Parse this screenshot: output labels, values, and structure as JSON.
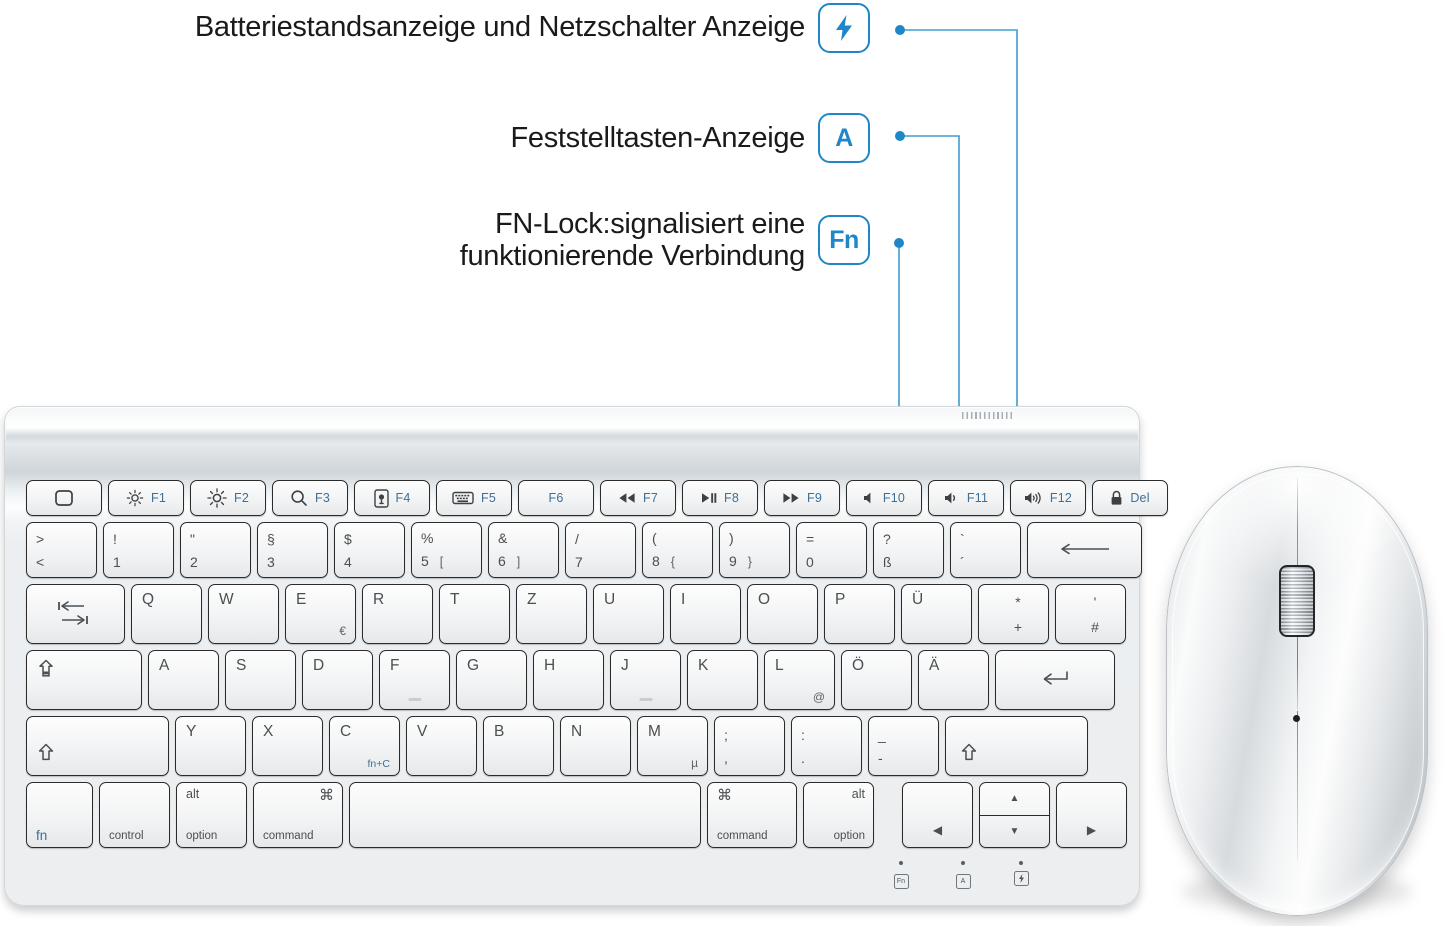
{
  "annotations": [
    {
      "id": "battery",
      "text": "Batteriestandsanzeige und Netzschalter Anzeige",
      "badge_icon": "lightning-bolt-icon",
      "badge_label": ""
    },
    {
      "id": "capslock",
      "text": "Feststelltasten-Anzeige",
      "badge_icon": "letter-a-icon",
      "badge_label": "A"
    },
    {
      "id": "fnlock",
      "text": "FN-Lock:signalisiert eine\nfunktionierende Verbindung",
      "badge_icon": "fn-icon",
      "badge_label": "Fn"
    }
  ],
  "colors": {
    "accent_blue": "#1f87c8",
    "connector_line": "#3f9dd0",
    "key_legend": "#4a4f53",
    "fn_blue": "#3f6f95",
    "body_silver": "#eceef0"
  },
  "keyboard": {
    "leds": [
      {
        "icon": "fn-indicator-icon",
        "label": "Fn"
      },
      {
        "icon": "capslock-indicator-icon",
        "label": "A"
      },
      {
        "icon": "battery-indicator-icon",
        "label": ""
      }
    ],
    "function_row": [
      {
        "glyph": "screen-icon",
        "label": ""
      },
      {
        "glyph": "brightness-down-icon",
        "label": "F1"
      },
      {
        "glyph": "brightness-up-icon",
        "label": "F2"
      },
      {
        "glyph": "search-icon",
        "label": "F3"
      },
      {
        "glyph": "microphone-icon",
        "label": "F4"
      },
      {
        "glyph": "keyboard-backlight-icon",
        "label": "F5"
      },
      {
        "glyph": "",
        "label": "F6"
      },
      {
        "glyph": "rewind-icon",
        "label": "F7"
      },
      {
        "glyph": "play-pause-icon",
        "label": "F8"
      },
      {
        "glyph": "fast-forward-icon",
        "label": "F9"
      },
      {
        "glyph": "mute-icon",
        "label": "F10"
      },
      {
        "glyph": "volume-down-icon",
        "label": "F11"
      },
      {
        "glyph": "volume-up-icon",
        "label": "F12"
      },
      {
        "glyph": "lock-icon",
        "label": "Del"
      }
    ],
    "number_row": [
      {
        "top": ">",
        "bottom": "<",
        "alt": ""
      },
      {
        "top": "!",
        "bottom": "1",
        "alt": ""
      },
      {
        "top": "\"",
        "bottom": "2",
        "alt": ""
      },
      {
        "top": "§",
        "bottom": "3",
        "alt": ""
      },
      {
        "top": "$",
        "bottom": "4",
        "alt": ""
      },
      {
        "top": "%",
        "bottom": "5",
        "alt": "["
      },
      {
        "top": "&",
        "bottom": "6",
        "alt": "]"
      },
      {
        "top": "/",
        "bottom": "7",
        "alt": ""
      },
      {
        "top": "(",
        "bottom": "8",
        "alt": "{"
      },
      {
        "top": ")",
        "bottom": "9",
        "alt": "}"
      },
      {
        "top": "=",
        "bottom": "0",
        "alt": ""
      },
      {
        "top": "?",
        "bottom": "ß",
        "alt": ""
      },
      {
        "top": "`",
        "bottom": "´",
        "alt": ""
      },
      {
        "top": "",
        "bottom": "",
        "alt": "",
        "icon": "backspace-icon"
      }
    ],
    "qwertz_row": [
      {
        "main": "",
        "sub": "",
        "icon": "tab-icon"
      },
      {
        "main": "Q",
        "sub": ""
      },
      {
        "main": "W",
        "sub": ""
      },
      {
        "main": "E",
        "sub": "€"
      },
      {
        "main": "R",
        "sub": ""
      },
      {
        "main": "T",
        "sub": ""
      },
      {
        "main": "Z",
        "sub": ""
      },
      {
        "main": "U",
        "sub": ""
      },
      {
        "main": "I",
        "sub": ""
      },
      {
        "main": "O",
        "sub": ""
      },
      {
        "main": "P",
        "sub": ""
      },
      {
        "main": "Ü",
        "sub": ""
      },
      {
        "main": "*",
        "sub": "+"
      },
      {
        "main": "'",
        "sub": "#"
      }
    ],
    "home_row": [
      {
        "main": "",
        "sub": "",
        "icon": "capslock-icon"
      },
      {
        "main": "A",
        "sub": ""
      },
      {
        "main": "S",
        "sub": ""
      },
      {
        "main": "D",
        "sub": ""
      },
      {
        "main": "F",
        "sub": "",
        "bump": true
      },
      {
        "main": "G",
        "sub": ""
      },
      {
        "main": "H",
        "sub": ""
      },
      {
        "main": "J",
        "sub": "",
        "bump": true
      },
      {
        "main": "K",
        "sub": ""
      },
      {
        "main": "L",
        "sub": "@"
      },
      {
        "main": "Ö",
        "sub": ""
      },
      {
        "main": "Ä",
        "sub": ""
      },
      {
        "main": "",
        "sub": "",
        "icon": "return-icon"
      }
    ],
    "bottom_letter_row": [
      {
        "main": "",
        "sub": "",
        "icon": "shift-icon"
      },
      {
        "main": "Y",
        "sub": ""
      },
      {
        "main": "X",
        "sub": ""
      },
      {
        "main": "C",
        "sub": "fn+C",
        "sub_blue": true
      },
      {
        "main": "V",
        "sub": ""
      },
      {
        "main": "B",
        "sub": ""
      },
      {
        "main": "N",
        "sub": ""
      },
      {
        "main": "M",
        "sub": "µ"
      },
      {
        "main": ";",
        "sub": ","
      },
      {
        "main": ":",
        "sub": "."
      },
      {
        "main": "_",
        "sub": "-"
      },
      {
        "main": "",
        "sub": "",
        "icon": "shift-icon"
      }
    ],
    "modifier_row": [
      {
        "top": "",
        "bottom": "fn",
        "style": "fn"
      },
      {
        "top": "",
        "bottom": "control",
        "style": "plain"
      },
      {
        "top": "alt",
        "bottom": "option",
        "style": "stacked"
      },
      {
        "top": "⌘",
        "bottom": "command",
        "style": "stacked"
      },
      {
        "top": "",
        "bottom": "",
        "style": "space"
      },
      {
        "top": "⌘",
        "bottom": "command",
        "style": "stacked"
      },
      {
        "top": "alt",
        "bottom": "option",
        "style": "stacked"
      },
      {
        "top": "",
        "bottom": "◀",
        "style": "arrow"
      },
      {
        "top": "▲",
        "bottom": "▼",
        "style": "updown"
      },
      {
        "top": "",
        "bottom": "▶",
        "style": "arrow"
      }
    ]
  },
  "mouse": {
    "parts": [
      {
        "name": "scroll-wheel"
      },
      {
        "name": "left-button"
      },
      {
        "name": "right-button"
      },
      {
        "name": "dpi-button"
      }
    ]
  }
}
